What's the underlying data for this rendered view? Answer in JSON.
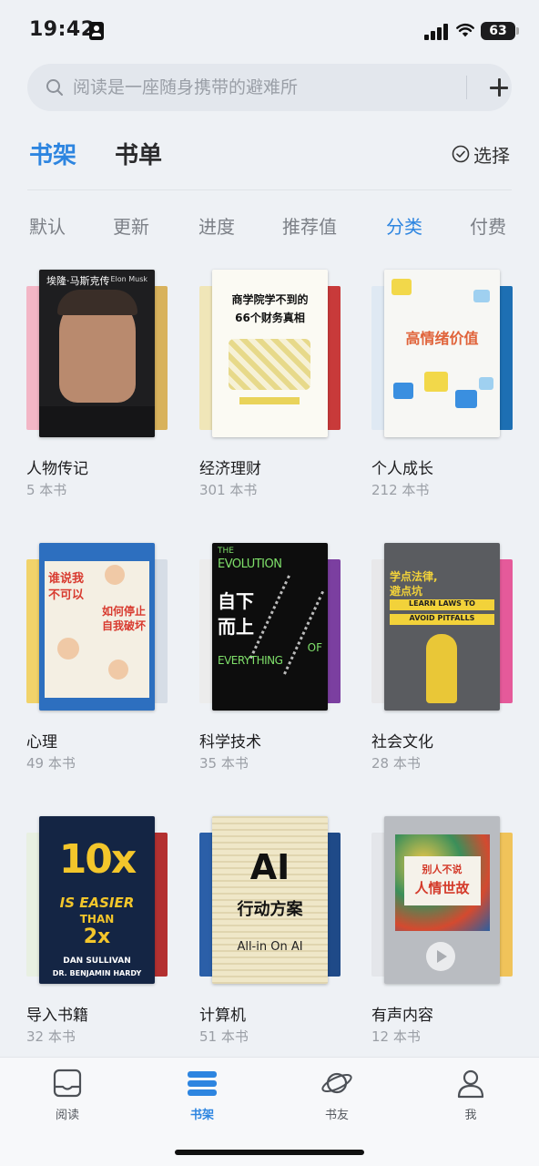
{
  "status_bar": {
    "time": "19:42",
    "battery": "63"
  },
  "search": {
    "placeholder": "阅读是一座随身携带的避难所"
  },
  "top_tabs": [
    {
      "label": "书架",
      "active": true
    },
    {
      "label": "书单",
      "active": false
    }
  ],
  "select_label": "选择",
  "sort_tabs": [
    {
      "label": "默认",
      "active": false
    },
    {
      "label": "更新",
      "active": false
    },
    {
      "label": "进度",
      "active": false
    },
    {
      "label": "推荐值",
      "active": false
    },
    {
      "label": "分类",
      "active": true
    },
    {
      "label": "付费",
      "active": false
    }
  ],
  "categories": [
    {
      "name": "人物传记",
      "count": "5 本书",
      "cover_lines": [
        "埃隆·马斯克传",
        "Elon Musk"
      ]
    },
    {
      "name": "经济理财",
      "count": "301 本书",
      "cover_lines": [
        "商学院学不到的",
        "66个财务真相"
      ]
    },
    {
      "name": "个人成长",
      "count": "212 本书",
      "cover_lines": [
        "高情绪价值"
      ]
    },
    {
      "name": "心理",
      "count": "49 本书",
      "cover_lines": [
        "谁说我",
        "不可以",
        "如何停止",
        "自我破坏"
      ]
    },
    {
      "name": "科学技术",
      "count": "35 本书",
      "cover_lines": [
        "THE",
        "EVOLUTION",
        "自下",
        "而上",
        "OF",
        "EVERYTHING"
      ]
    },
    {
      "name": "社会文化",
      "count": "28 本书",
      "cover_lines": [
        "学点法律,",
        "避点坑",
        "LEARN LAWS TO",
        "AVOID PITFALLS"
      ]
    },
    {
      "name": "导入书籍",
      "count": "32 本书",
      "cover_lines": [
        "10x",
        "IS EASIER",
        "THAN",
        "2x",
        "DAN SULLIVAN",
        "DR. BENJAMIN HARDY"
      ]
    },
    {
      "name": "计算机",
      "count": "51 本书",
      "cover_lines": [
        "AI",
        "行动方案",
        "All-in On AI"
      ]
    },
    {
      "name": "有声内容",
      "count": "12 本书",
      "cover_lines": [
        "别人不说",
        "人情世故"
      ]
    }
  ],
  "bottom_nav": [
    {
      "label": "阅读",
      "icon": "reading-icon",
      "active": false
    },
    {
      "label": "书架",
      "icon": "bookshelf-icon",
      "active": true
    },
    {
      "label": "书友",
      "icon": "planet-icon",
      "active": false
    },
    {
      "label": "我",
      "icon": "person-icon",
      "active": false
    }
  ],
  "colors": {
    "accent": "#2d85e0",
    "background": "#eef1f5"
  }
}
